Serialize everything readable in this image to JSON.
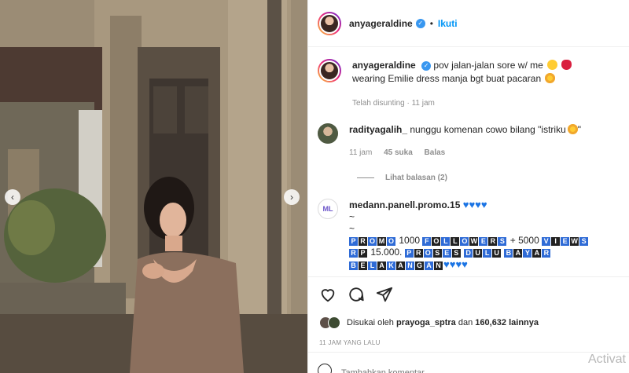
{
  "post": {
    "username": "anyageraldine",
    "follow_label": "Ikuti",
    "dot": "•"
  },
  "caption": {
    "username": "anyageraldine",
    "text_line1": "pov jalan-jalan sore w/ me",
    "text_line2": "wearing Emilie dress manja bgt buat pacaran",
    "edited": "Telah disunting · 11 jam"
  },
  "comments": [
    {
      "username": "radityagalih_",
      "text": "nunggu komenan cowo bilang \"istriku",
      "text_end": "\"",
      "time": "11 jam",
      "likes": "45 suka",
      "reply": "Balas",
      "view_replies": "Lihat balasan (2)"
    },
    {
      "username": "medann.panell.promo.15",
      "line2": "~",
      "line3": "~",
      "promo_words": [
        "PROMO",
        "FOLLOWERS",
        "VIEWS",
        "RP",
        "PROSES",
        "DULU",
        "BAYAR",
        "BELAKANGAN"
      ],
      "num1": "1000",
      "num2": "+ 5000",
      "num3": "15.000."
    }
  ],
  "likes": {
    "prefix": "Disukai oleh",
    "user": "prayoga_sptra",
    "and": "dan",
    "count": "160,632 lainnya"
  },
  "timestamp": "11 JAM YANG LALU",
  "add_comment": {
    "placeholder": "Tambahkan komentar..."
  },
  "watermark": "Activat",
  "icons": {
    "like": "heart-icon",
    "comment": "comment-icon",
    "share": "share-icon",
    "emoji": "emoji-icon",
    "verified": "verified-badge-icon"
  },
  "colors": {
    "link": "#0095f6",
    "verified": "#3897f0",
    "promo_blue": "#2f6bd6",
    "heart_blue": "#1b74e4"
  }
}
